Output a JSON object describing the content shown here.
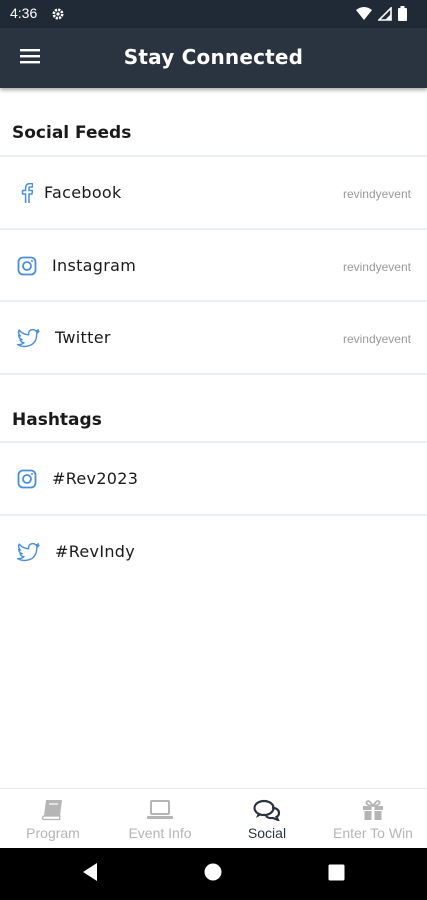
{
  "status_bar": {
    "time": "4:36"
  },
  "app_bar": {
    "title": "Stay Connected"
  },
  "social_feeds": {
    "title": "Social Feeds",
    "items": [
      {
        "label": "Facebook",
        "handle": "revindyevent",
        "icon": "facebook-icon"
      },
      {
        "label": "Instagram",
        "handle": "revindyevent",
        "icon": "instagram-icon"
      },
      {
        "label": "Twitter",
        "handle": "revindyevent",
        "icon": "twitter-icon"
      }
    ]
  },
  "hashtags": {
    "title": "Hashtags",
    "items": [
      {
        "label": "#Rev2023",
        "icon": "instagram-icon"
      },
      {
        "label": "#RevIndy",
        "icon": "twitter-icon"
      }
    ]
  },
  "bottom_nav": {
    "items": [
      {
        "label": "Program",
        "icon": "book-icon",
        "active": false
      },
      {
        "label": "Event Info",
        "icon": "laptop-icon",
        "active": false
      },
      {
        "label": "Social",
        "icon": "chat-bubbles-icon",
        "active": true
      },
      {
        "label": "Enter To Win",
        "icon": "gift-icon",
        "active": false
      }
    ]
  },
  "colors": {
    "app_bar": "#2a3440",
    "status_bar": "#1f2a36",
    "accent_icon": "#4a90d9",
    "inactive_nav": "#b5b5b5",
    "divider": "#eceff1"
  }
}
